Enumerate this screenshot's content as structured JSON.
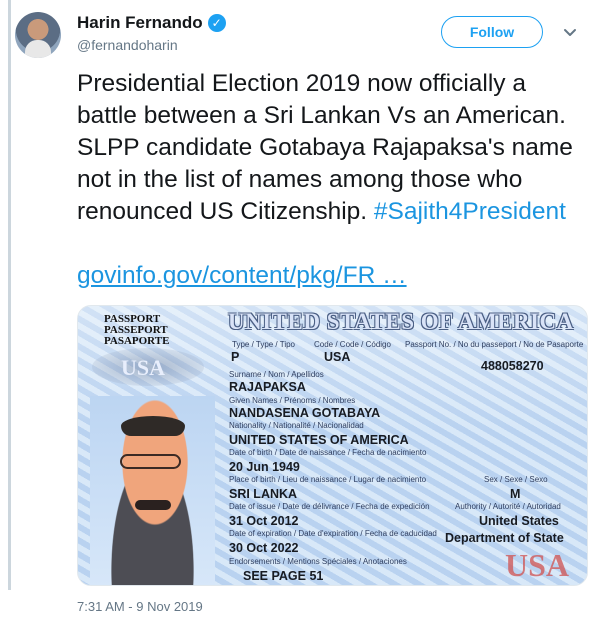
{
  "profile": {
    "name": "Harin Fernando",
    "handle": "@fernandoharin",
    "verified_icon": "verified-check-icon",
    "avatar_icon": "profile-avatar"
  },
  "actions": {
    "follow_label": "Follow",
    "menu_icon": "chevron-down-icon"
  },
  "tweet": {
    "text_main": "Presidential Election 2019 now officially a battle between a Sri Lankan Vs an American. SLPP candidate Gotabaya Rajapaksa's name not in the list of names among those who renounced US Citizenship. ",
    "hashtag": "#Sajith4President",
    "link": "govinfo.gov/content/pkg/FR …",
    "timestamp": "7:31 AM - 9 Nov 2019"
  },
  "image": {
    "header_lines": [
      "PASSPORT",
      "PASSEPORT",
      "PASAPORTE"
    ],
    "title": "UNITED STATES OF AMERICA",
    "left_seal_text": "USA",
    "fields": {
      "type_label": "Type / Type / Tipo",
      "type_value": "P",
      "code_label": "Code / Code / Código",
      "code_value": "USA",
      "passport_no_label": "Passport No. / No du passeport / No de Pasaporte",
      "passport_no": "488058270",
      "surname_label": "Surname / Nom / Apellidos",
      "surname": "RAJAPAKSA",
      "given_label": "Given Names / Prénoms / Nombres",
      "given_names": "NANDASENA GOTABAYA",
      "nationality_label": "Nationality / Nationalité / Nacionalidad",
      "nationality": "UNITED STATES OF AMERICA",
      "dob_label": "Date of birth / Date de naissance / Fecha de nacimiento",
      "dob": "20 Jun 1949",
      "pob_label": "Place of birth / Lieu de naissance / Lugar de nacimiento",
      "pob": "SRI LANKA",
      "sex_label": "Sex / Sexe / Sexo",
      "sex": "M",
      "issue_label": "Date of issue / Date de délivrance / Fecha de expedición",
      "issue_date": "31 Oct 2012",
      "authority_label": "Authority / Autorité / Autoridad",
      "authority_1": "United States",
      "authority_2": "Department of State",
      "expiry_label": "Date of expiration / Date d'expiration / Fecha de caducidad",
      "expiry_date": "30 Oct 2022",
      "endorsements_label": "Endorsements / Mentions Spéciales / Anotaciones",
      "endorsements": "SEE PAGE 51"
    },
    "footer_text": "USA"
  }
}
